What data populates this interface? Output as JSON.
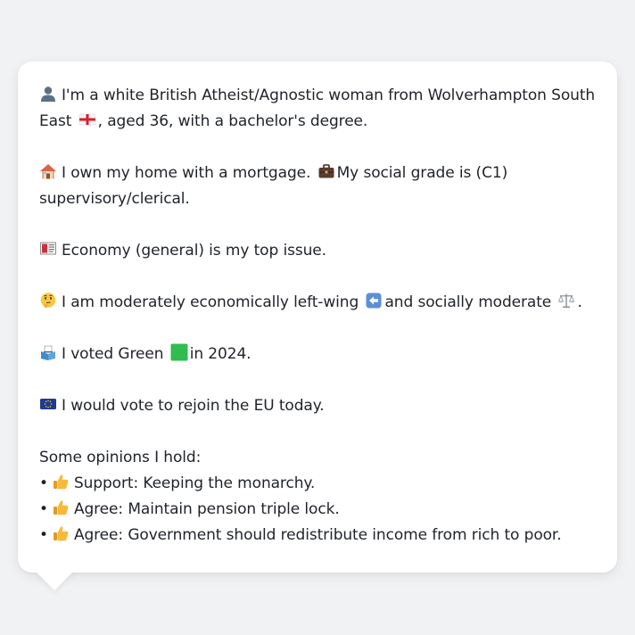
{
  "profile": {
    "identity": {
      "prefix_icon": "person-silhouette-icon",
      "text_a": "I'm a white British Atheist/Agnostic woman from Wolverhampton South East",
      "flag_icon": "england-flag-icon",
      "text_b": ", aged 36, with a bachelor's degree."
    },
    "housing": {
      "prefix_icon": "house-icon",
      "text_a": "I own my home with a mortgage.",
      "briefcase_icon": "briefcase-icon",
      "text_b": "My social grade is (C1) supervisory/clerical."
    },
    "issue": {
      "prefix_icon": "newspaper-icon",
      "text": "Economy (general) is my top issue."
    },
    "ideology": {
      "prefix_icon": "thinking-face-icon",
      "text_a": "I am moderately economically left-wing",
      "left_arrow_icon": "left-arrow-icon",
      "text_b": "and socially moderate",
      "scales_icon": "balance-scale-icon",
      "text_c": "."
    },
    "vote": {
      "prefix_icon": "ballot-box-icon",
      "text_a": "I voted Green",
      "green_square_icon": "green-square-icon",
      "text_b": "in 2024."
    },
    "eu": {
      "prefix_icon": "eu-flag-icon",
      "text": "I would vote to rejoin the EU today."
    },
    "opinions": {
      "heading": "Some opinions I hold:",
      "bullet_char": "•",
      "items": [
        {
          "icon": "thumbs-up-icon",
          "text": "Support: Keeping the monarchy."
        },
        {
          "icon": "thumbs-up-icon",
          "text": "Agree: Maintain pension triple lock."
        },
        {
          "icon": "thumbs-up-icon",
          "text": "Agree: Government should redistribute income from rich to poor."
        }
      ]
    }
  },
  "colors": {
    "background": "#f1f2f4",
    "bubble": "#ffffff",
    "text": "#1f2329",
    "green_square": "#22c55e",
    "eu_blue": "#1e3a8a",
    "thumb_yellow": "#f6b93b"
  }
}
